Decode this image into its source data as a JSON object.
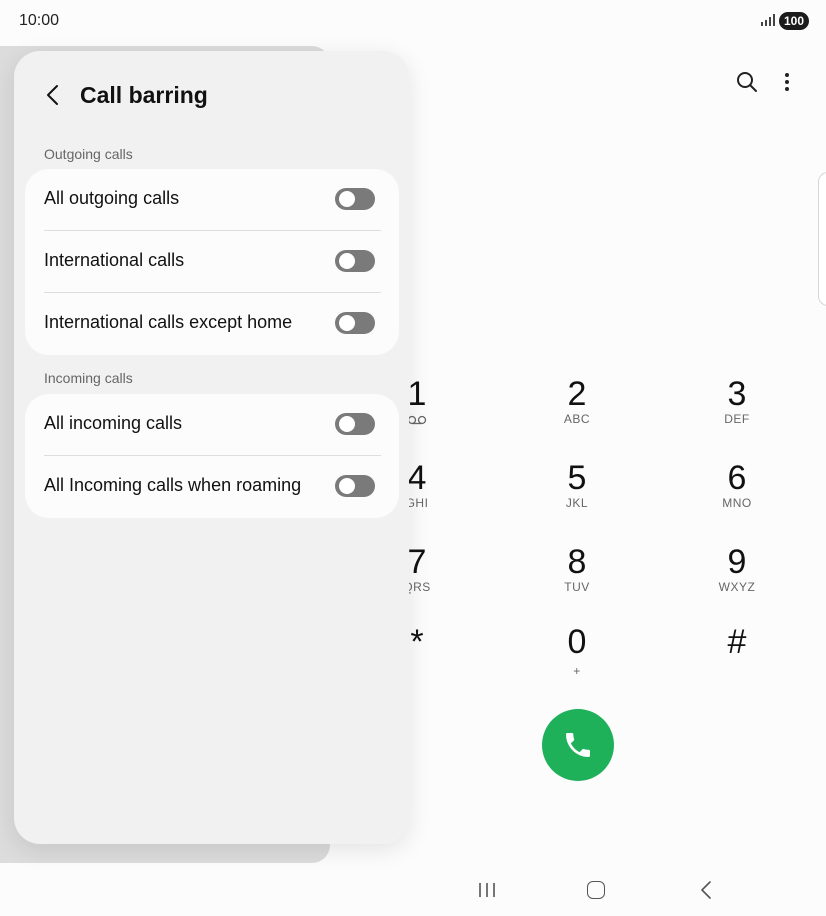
{
  "status_bar": {
    "time": "10:00",
    "battery": "100"
  },
  "dialer": {
    "keys": [
      {
        "digit": "1",
        "letters": ""
      },
      {
        "digit": "2",
        "letters": "ABC"
      },
      {
        "digit": "3",
        "letters": "DEF"
      },
      {
        "digit": "4",
        "letters": "GHI"
      },
      {
        "digit": "5",
        "letters": "JKL"
      },
      {
        "digit": "6",
        "letters": "MNO"
      },
      {
        "digit": "7",
        "letters": "QRS"
      },
      {
        "digit": "8",
        "letters": "TUV"
      },
      {
        "digit": "9",
        "letters": "WXYZ"
      },
      {
        "digit": "*",
        "letters": ""
      },
      {
        "digit": "0",
        "letters": "+"
      },
      {
        "digit": "#",
        "letters": ""
      }
    ],
    "accent_color": "#1fb05a"
  },
  "panel": {
    "title": "Call barring",
    "outgoing": {
      "label": "Outgoing calls",
      "items": [
        {
          "label": "All outgoing calls",
          "enabled": false
        },
        {
          "label": "International calls",
          "enabled": false
        },
        {
          "label": "International calls except home",
          "enabled": false
        }
      ]
    },
    "incoming": {
      "label": "Incoming calls",
      "items": [
        {
          "label": "All incoming calls",
          "enabled": false
        },
        {
          "label": "All Incoming calls when roaming",
          "enabled": false
        }
      ]
    }
  }
}
